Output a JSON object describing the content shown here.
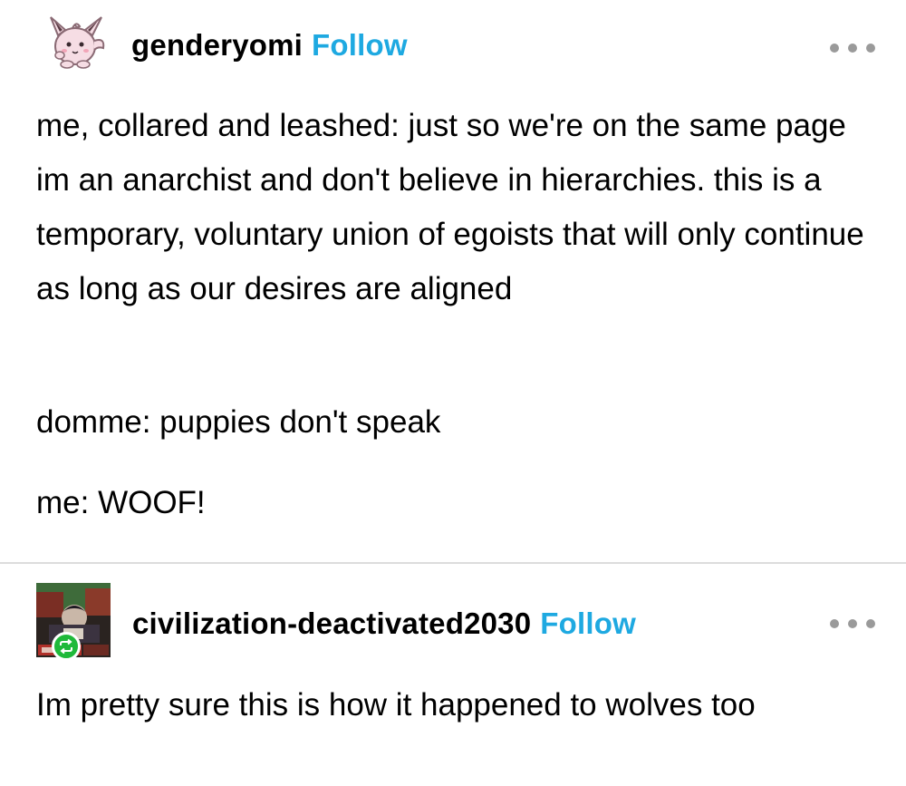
{
  "post": {
    "username": "genderyomi",
    "follow_label": "Follow",
    "avatar_icon": "clefairy-avatar-icon",
    "paragraphs": [
      "me, collared and leashed: just so we're on the same page im an anarchist and don't believe in hierarchies. this is a temporary, voluntary union of egoists that will only continue as long as our desires are aligned",
      "domme: puppies don't speak",
      "me: WOOF!"
    ]
  },
  "reply": {
    "username": "civilization-deactivated2030",
    "follow_label": "Follow",
    "avatar_icon": "dark-collage-avatar-icon",
    "badge_icon": "reblog-icon",
    "text": "Im pretty sure this is how it happened to wolves too"
  },
  "colors": {
    "follow": "#1ea9e1",
    "more_dots": "#9a9a9a",
    "divider": "#dcdcdc",
    "reblog_badge": "#1fb93a"
  }
}
